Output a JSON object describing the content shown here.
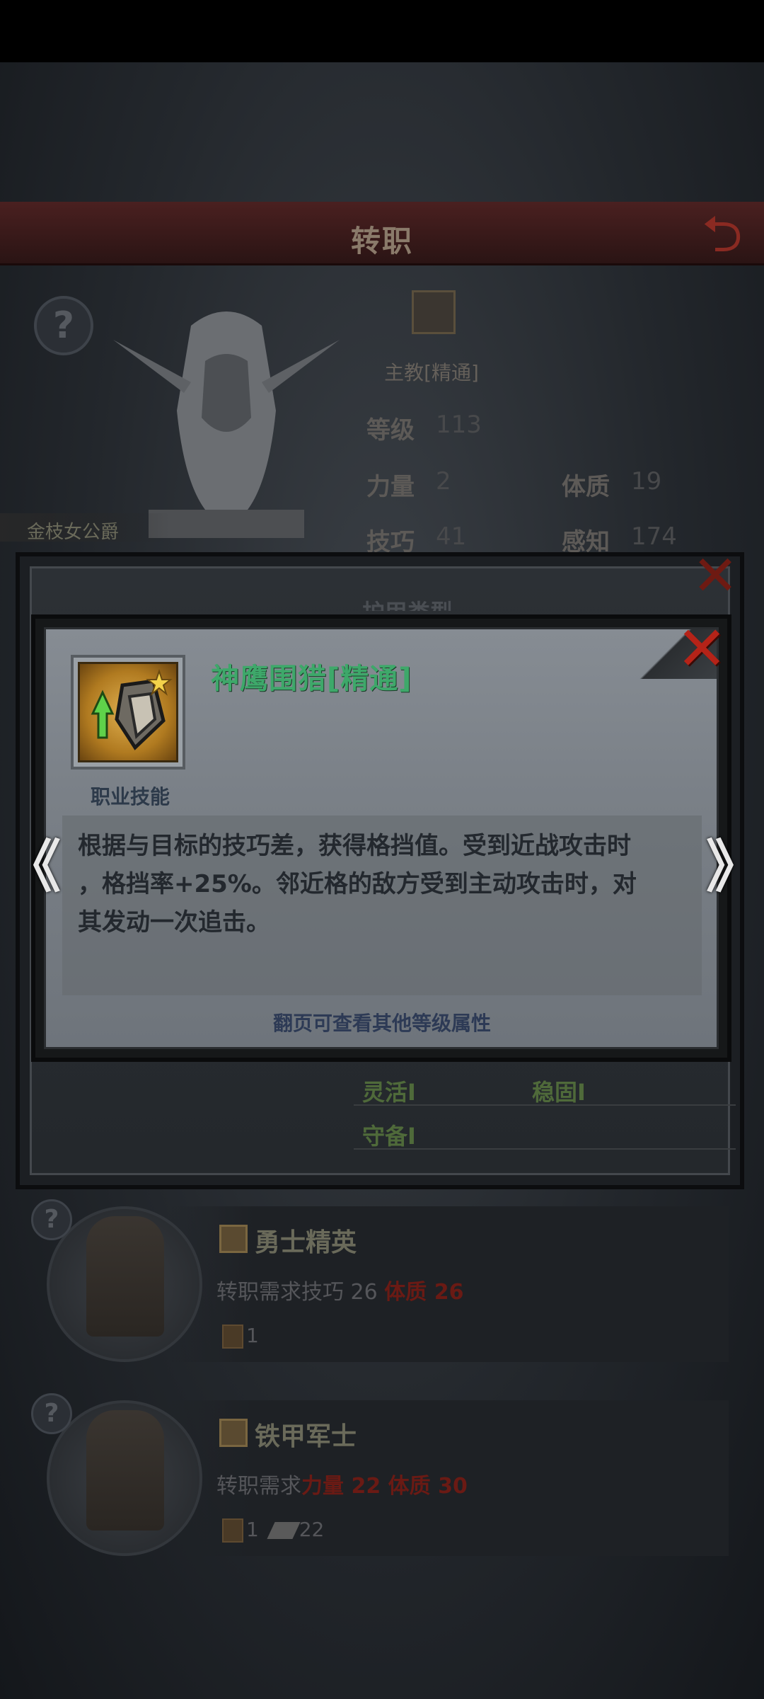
{
  "header": {
    "title": "转职",
    "back_icon": "back-arrow-icon"
  },
  "character": {
    "name": "金枝女公爵",
    "class_name": "主教[精通]",
    "stats": [
      {
        "label": "等级",
        "value": "113"
      },
      {
        "label": "力量",
        "value": "2"
      },
      {
        "label": "体质",
        "value": "19"
      },
      {
        "label": "技巧",
        "value": "41"
      },
      {
        "label": "感知",
        "value": "174"
      }
    ]
  },
  "back_dialog": {
    "partial_heading": "护甲类型",
    "tags": [
      "灵活I",
      "稳固I",
      "守备I"
    ]
  },
  "skill_dialog": {
    "name": "神鹰围猎[精通]",
    "type": "职业技能",
    "description_lines": [
      "根据与目标的技巧差，获得格挡值。受到近战攻击时",
      "，格挡率+25%。邻近格的敌方受到主动攻击时，对",
      "其发动一次追击。"
    ],
    "page_hint": "翻页可查看其他等级属性",
    "prev_label": "《",
    "next_label": "》",
    "close_label": "✕"
  },
  "classes": [
    {
      "name": "勇士精英",
      "req_prefix": "转职需求技巧 26 ",
      "req_missing": "体质 26",
      "resources": [
        {
          "icon": "medal-icon",
          "count": "1"
        }
      ]
    },
    {
      "name": "铁甲军士",
      "req_prefix": "转职需求",
      "req_missing": "力量 22 体质 30",
      "resources": [
        {
          "icon": "medal-icon",
          "count": "1"
        },
        {
          "icon": "iron-ingot-icon",
          "count": "22"
        }
      ]
    }
  ],
  "colors": {
    "skill_name": "#3ea86a",
    "close_red": "#b52318",
    "requirement_missing": "#6a1a14"
  }
}
